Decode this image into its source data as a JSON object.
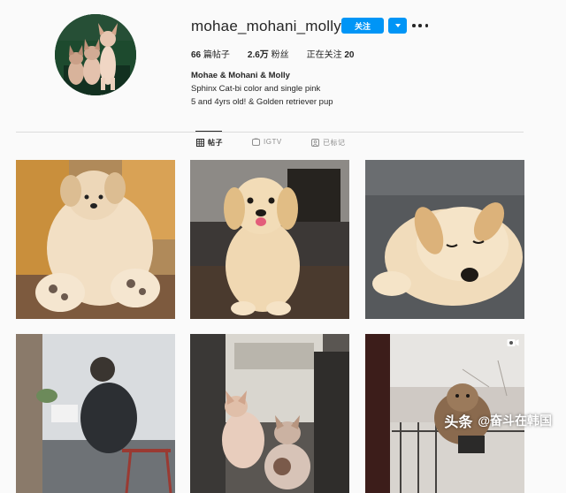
{
  "profile": {
    "username": "mohae_mohani_molly",
    "follow_label": "关注",
    "stats": [
      {
        "count": "66",
        "label": "篇帖子"
      },
      {
        "count": "2.6万",
        "label": "粉丝"
      },
      {
        "prefix": "正在关注",
        "count": "20"
      }
    ],
    "bio": {
      "name": "Mohae & Mohani & Molly",
      "lines": [
        "Sphinx Cat-bi color and single pink",
        "5 and 4yrs old! & Golden retriever pup"
      ]
    }
  },
  "tabs": [
    {
      "label": "帖子",
      "icon": "grid-icon",
      "active": true
    },
    {
      "label": "IGTV",
      "icon": "igtv-icon",
      "active": false
    },
    {
      "label": "已标记",
      "icon": "tagged-icon",
      "active": false
    }
  ],
  "posts": [
    {
      "subject": "golden puppy lying on back",
      "icon": "photo"
    },
    {
      "subject": "golden puppy sitting",
      "icon": "photo"
    },
    {
      "subject": "golden puppy sleeping",
      "icon": "photo"
    },
    {
      "subject": "person sitting by window",
      "icon": "photo"
    },
    {
      "subject": "sphynx cats",
      "icon": "photo"
    },
    {
      "subject": "dog outdoors in snow",
      "icon": "video-icon"
    }
  ],
  "watermark": {
    "brand": "头条",
    "handle": "@奋斗在韩国"
  },
  "colors": {
    "accent": "#0095f6",
    "background": "#fafafa",
    "text": "#262626",
    "muted": "#8e8e8e"
  }
}
